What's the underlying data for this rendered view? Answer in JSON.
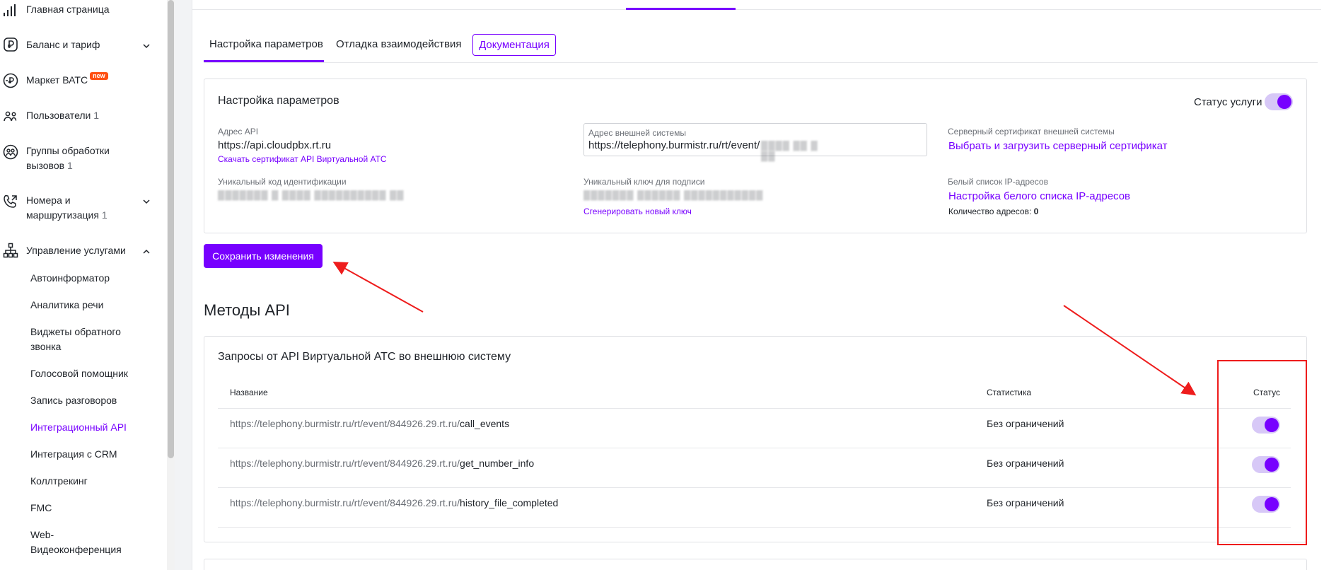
{
  "sidebar": {
    "items": [
      {
        "label": "Главная страница",
        "icon": "chart-bars-icon",
        "count": ""
      },
      {
        "label": "Баланс и тариф",
        "icon": "ruble-document-icon",
        "count": ""
      },
      {
        "label": "Маркет ВАТС",
        "icon": "market-icon",
        "badge": "new",
        "count": ""
      },
      {
        "label": "Пользователи",
        "icon": "users-icon",
        "count": "1"
      },
      {
        "label": "Группы обработки вызовов",
        "icon": "call-group-icon",
        "count": "1"
      },
      {
        "label": "Номера и маршрутизация",
        "icon": "phone-routing-icon",
        "count": "1"
      },
      {
        "label": "Управление услугами",
        "icon": "hierarchy-icon",
        "count": ""
      }
    ],
    "sub_items": [
      "Автоинформатор",
      "Аналитика речи",
      "Виджеты обратного звонка",
      "Голосовой помощник",
      "Запись разговоров",
      "Интеграционный API",
      "Интеграция с CRM",
      "Коллтрекинг",
      "FMC",
      "Web-Видеоконференция"
    ],
    "active_sub": "Интеграционный API"
  },
  "tabs": {
    "params": "Настройка параметров",
    "debug": "Отладка взаимодействия",
    "docs": "Документация"
  },
  "settings": {
    "title": "Настройка параметров",
    "service_status_label": "Статус услуги",
    "service_status_on": true,
    "api_address_label": "Адрес API",
    "api_address_value": "https://api.cloudpbx.rt.ru",
    "download_cert_link": "Скачать сертификат API Виртуальной АТС",
    "ext_address_label": "Адрес внешней системы",
    "ext_address_value": "https://telephony.burmistr.ru/rt/event/",
    "server_cert_label": "Серверный сертификат внешней системы",
    "server_cert_link": "Выбрать и загрузить серверный сертификат",
    "unique_code_label": "Уникальный код идентификации",
    "unique_key_label": "Уникальный ключ для подписи",
    "generate_key_link": "Сгенерировать новый ключ",
    "whitelist_label": "Белый список IP-адресов",
    "whitelist_link": "Настройка белого списка IP-адресов",
    "address_count_label": "Количество адресов:",
    "address_count_value": "0"
  },
  "save_button": "Сохранить изменения",
  "methods": {
    "heading": "Методы API",
    "panel_title": "Запросы от API Виртуальной АТС во внешнюю систему",
    "columns": {
      "name": "Название",
      "stats": "Статистика",
      "status": "Статус"
    },
    "rows": [
      {
        "base": "https://telephony.burmistr.ru/rt/event/844926.29.rt.ru/",
        "tail": "call_events",
        "stats": "Без ограничений",
        "enabled": true
      },
      {
        "base": "https://telephony.burmistr.ru/rt/event/844926.29.rt.ru/",
        "tail": "get_number_info",
        "stats": "Без ограничений",
        "enabled": true
      },
      {
        "base": "https://telephony.burmistr.ru/rt/event/844926.29.rt.ru/",
        "tail": "history_file_completed",
        "stats": "Без ограничений",
        "enabled": true
      }
    ]
  },
  "colors": {
    "accent": "#7700ff",
    "annotation": "#ee1c1c",
    "badge": "#ff4f12"
  }
}
